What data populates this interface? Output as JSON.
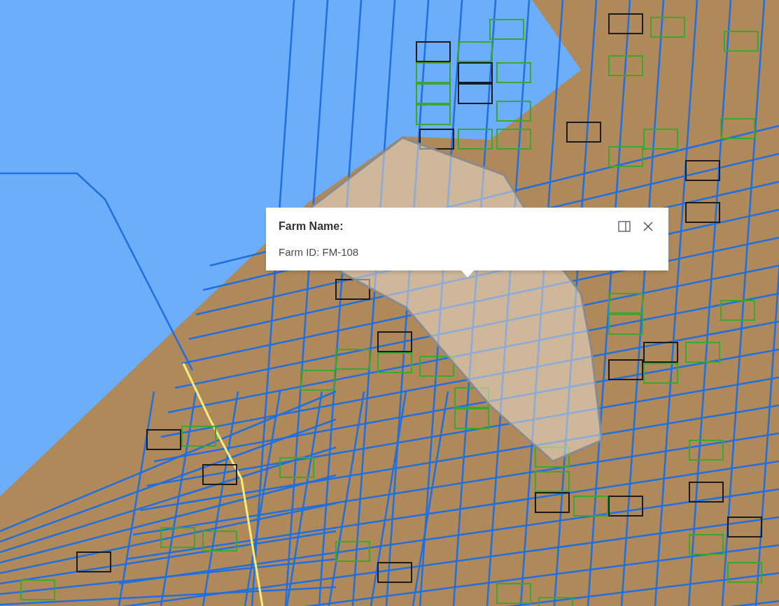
{
  "popup": {
    "title": "Farm Name:",
    "lines": [
      "Farm ID: FM-108"
    ]
  }
}
